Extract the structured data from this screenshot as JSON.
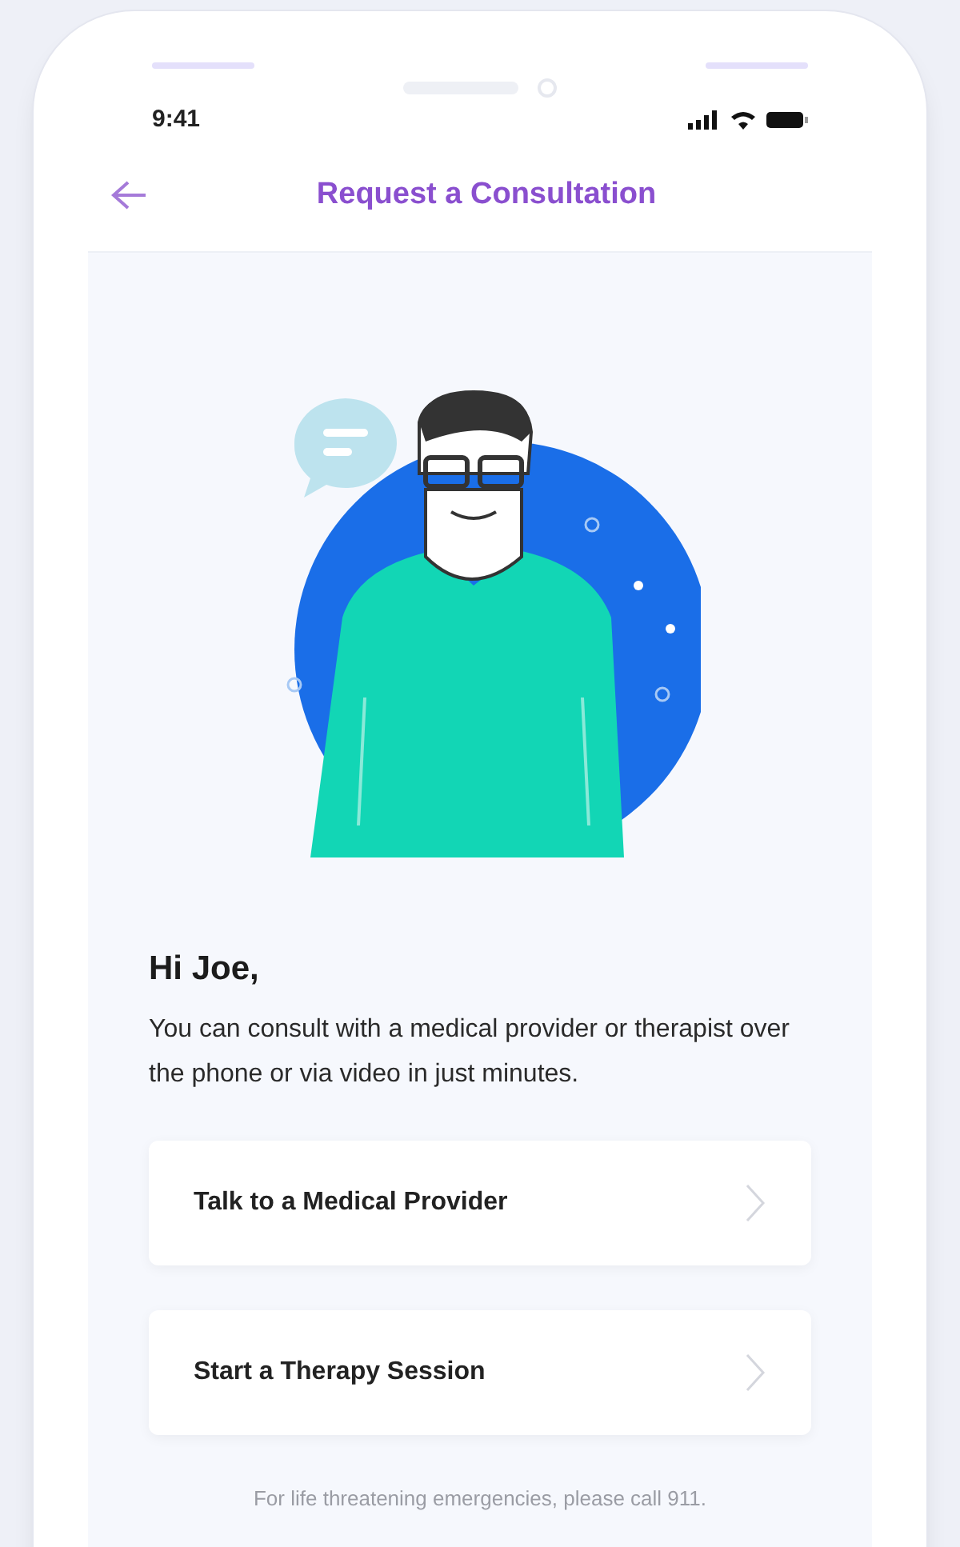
{
  "status_bar": {
    "time": "9:41"
  },
  "header": {
    "title": "Request a Consultation"
  },
  "greeting": "Hi Joe,",
  "intro": "You can consult with a medical provider or therapist over the phone or via video in just minutes.",
  "options": [
    {
      "label": "Talk to a Medical Provider"
    },
    {
      "label": "Start a Therapy Session"
    }
  ],
  "footer_note": "For life threatening emergencies, please call 911."
}
